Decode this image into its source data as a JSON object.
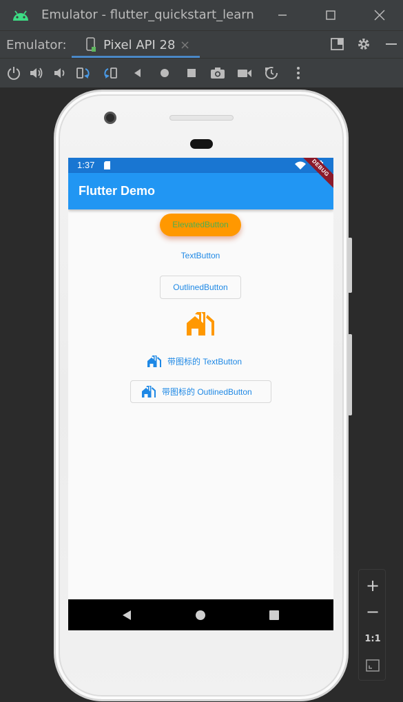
{
  "window": {
    "title": "Emulator - flutter_quickstart_learn"
  },
  "tabbar": {
    "label": "Emulator:",
    "tab_label": "Pixel API 28",
    "tab_close": "×"
  },
  "device": {
    "status_time": "1:37",
    "app_title": "Flutter Demo",
    "debug_banner": "DEBUG",
    "buttons": {
      "elevated": "ElevatedButton",
      "text": "TextButton",
      "outlined": "OutlinedButton",
      "text_with_icon": "带图标的 TextButton",
      "outlined_with_icon": "带图标的 OutlinedButton"
    }
  },
  "zoom": {
    "zoom_in": "+",
    "zoom_out": "−",
    "ratio": "1:1"
  },
  "colors": {
    "appbar": "#2196f3",
    "statusbar": "#1976d2",
    "elevated_bg": "#ff9800",
    "elevated_text": "#4caf50",
    "button_text": "#1e88e5",
    "icon_orange": "#ff9800"
  },
  "icons": {
    "app": "android-icon",
    "window_minimize": "minimize-icon",
    "window_maximize": "maximize-icon",
    "window_close": "close-icon",
    "content_icon": "home-work-icon"
  }
}
